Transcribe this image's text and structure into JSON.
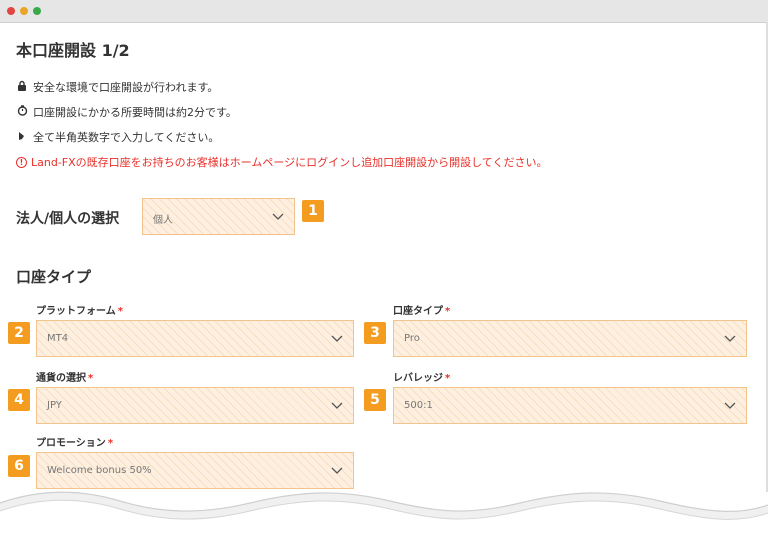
{
  "page": {
    "title": "本口座開設 1/2"
  },
  "notes": [
    {
      "icon": "lock-icon",
      "glyph": "🔒",
      "text": "安全な環境で口座開設が行われます。"
    },
    {
      "icon": "timer-icon",
      "glyph": "⏱",
      "text": "口座開設にかかる所要時間は約2分です。"
    },
    {
      "icon": "pen-icon",
      "glyph": "✎",
      "text": "全て半角英数字で入力してください。"
    }
  ],
  "warning": {
    "icon": "warning-circle-icon",
    "glyph": "!",
    "text": "Land-FXの既存口座をお持ちのお客様はホームページにログインし追加口座開設から開設してください。"
  },
  "entity": {
    "label": "法人/個人の選択",
    "value": "個人",
    "badge": "1"
  },
  "account_type_section": {
    "title": "口座タイプ"
  },
  "fields": {
    "platform": {
      "label": "プラットフォーム",
      "value": "MT4",
      "badge": "2"
    },
    "account_type": {
      "label": "口座タイプ",
      "value": "Pro",
      "badge": "3"
    },
    "currency": {
      "label": "通貨の選択",
      "value": "JPY",
      "badge": "4"
    },
    "leverage": {
      "label": "レバレッジ",
      "value": "500:1",
      "badge": "5"
    },
    "promotion": {
      "label": "プロモーション",
      "value": "Welcome bonus 50%",
      "badge": "6"
    }
  },
  "required_mark": "*",
  "colors": {
    "badge": "#f39c1f",
    "warning": "#e8302a",
    "field_bg": "#fdf0e1",
    "field_border": "#f2c38a"
  }
}
